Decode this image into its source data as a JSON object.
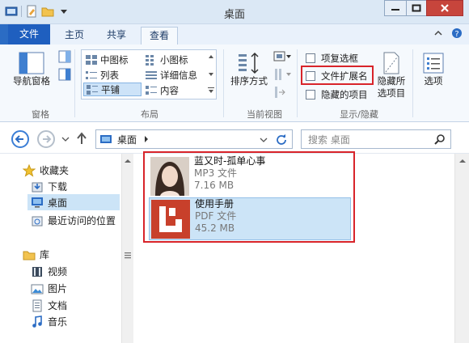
{
  "window": {
    "title": "桌面"
  },
  "tabs": {
    "file": "文件",
    "home": "主页",
    "share": "共享",
    "view": "查看"
  },
  "ribbon": {
    "panes": {
      "nav_pane": "导航窗格",
      "group_label": "窗格"
    },
    "layout": {
      "items": [
        "中图标",
        "小图标",
        "列表",
        "详细信息",
        "平铺",
        "内容"
      ],
      "group_label": "布局"
    },
    "current_view": {
      "sort": "排序方式",
      "group_label": "当前视图"
    },
    "show_hide": {
      "item_checkboxes": "项复选框",
      "file_extensions": "文件扩展名",
      "hidden_items": "隐藏的项目",
      "hide_selected": "隐藏所选项目",
      "group_label": "显示/隐藏"
    },
    "options": "选项"
  },
  "address": {
    "location": "桌面",
    "search_placeholder": "搜索 桌面"
  },
  "nav": {
    "favorites": "收藏夹",
    "downloads": "下载",
    "desktop": "桌面",
    "recent": "最近访问的位置",
    "libraries": "库",
    "videos": "视频",
    "pictures": "图片",
    "documents": "文档",
    "music": "音乐"
  },
  "files": [
    {
      "name": "蓝又时-孤单心事",
      "type": "MP3 文件",
      "size": "7.16 MB"
    },
    {
      "name": "使用手册",
      "type": "PDF 文件",
      "size": "45.2 MB"
    }
  ],
  "colors": {
    "accent": "#2b6cc4",
    "selection": "#cce4f7",
    "highlight_box": "#d8242a",
    "pdf_red": "#c8402b"
  }
}
